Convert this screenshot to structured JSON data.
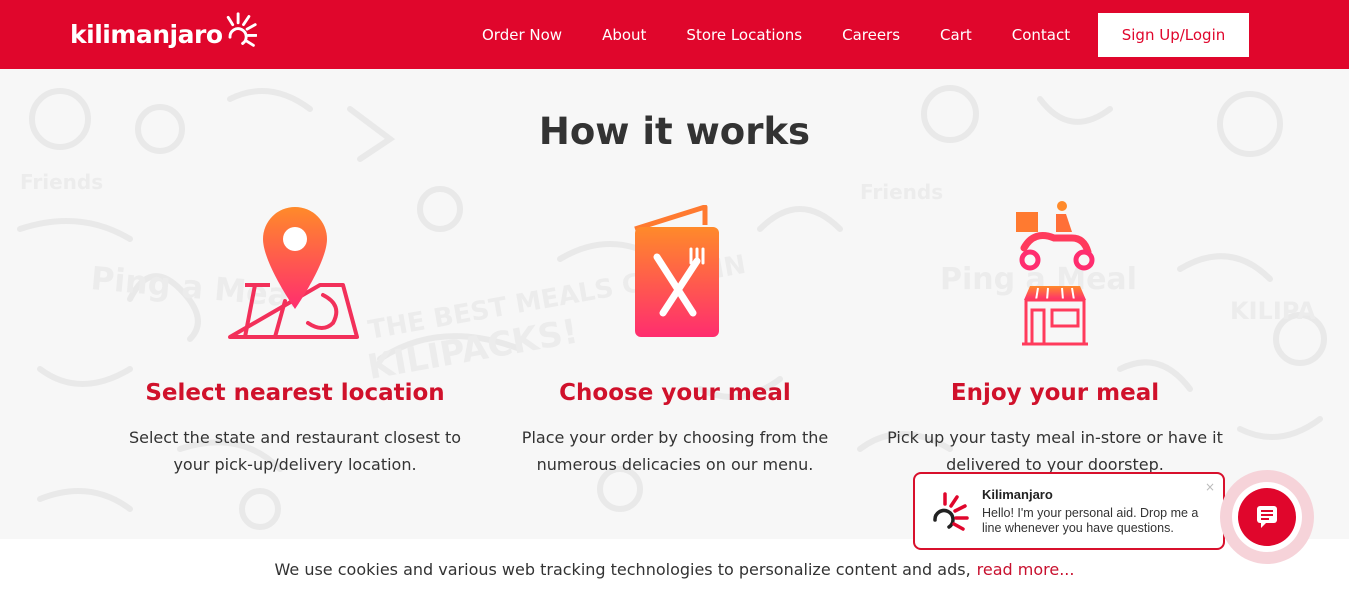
{
  "header": {
    "logo_text": "kilimanjaro",
    "nav": [
      "Order Now",
      "About",
      "Store Locations",
      "Careers",
      "Cart",
      "Contact"
    ],
    "signup_label": "Sign Up/Login"
  },
  "main": {
    "title": "How it works",
    "steps": [
      {
        "icon": "map-pin-icon",
        "title": "Select nearest location",
        "desc": "Select the state and restaurant closest to your pick-up/delivery location."
      },
      {
        "icon": "menu-book-icon",
        "title": "Choose your meal",
        "desc": "Place your order by choosing from the numerous delicacies on our menu."
      },
      {
        "icon": "delivery-store-icon",
        "title": "Enjoy your meal",
        "desc": "Pick up your tasty meal in-store or have it delivered to your doorstep."
      }
    ]
  },
  "cookie": {
    "text": "We use cookies and various web tracking technologies to personalize content and ads,",
    "link": "read more..."
  },
  "chat": {
    "name": "Kilimanjaro",
    "message": "Hello! I'm your personal aid. Drop me a line whenever you have questions.",
    "close": "×"
  },
  "colors": {
    "brand_red": "#e0062c",
    "title_red": "#d0112b",
    "gradient_top": "#ff8a2a",
    "gradient_bottom": "#ff2d6f"
  }
}
